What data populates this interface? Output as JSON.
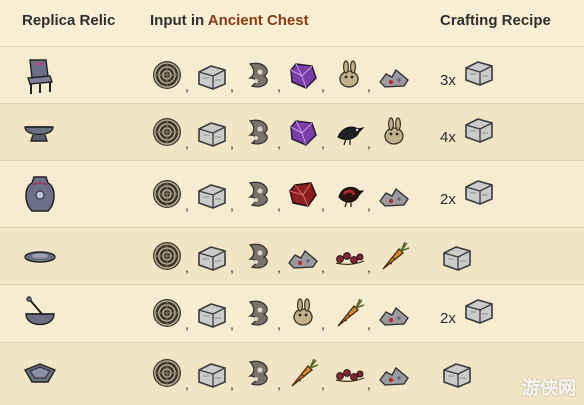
{
  "header": {
    "col_relic": "Replica Relic",
    "col_input_prefix": "Input in ",
    "col_input_accent": "Ancient Chest",
    "col_recipe": "Crafting Recipe"
  },
  "separator": ",",
  "rows": [
    {
      "relic_icon": "relic-chair-icon",
      "items": [
        "nightmare-fuel-icon",
        "thulecite-icon",
        "shadow-essence-icon",
        "purple-gem-icon",
        "rabbit-icon",
        "rocks-icon"
      ],
      "count": "3x",
      "recipe_icon": "thulecite-icon"
    },
    {
      "relic_icon": "relic-bowl-icon",
      "items": [
        "nightmare-fuel-icon",
        "thulecite-icon",
        "shadow-essence-icon",
        "purple-gem-icon",
        "crow-icon",
        "rabbit-icon"
      ],
      "count": "4x",
      "recipe_icon": "thulecite-icon"
    },
    {
      "relic_icon": "relic-vase-icon",
      "items": [
        "nightmare-fuel-icon",
        "thulecite-icon",
        "shadow-essence-icon",
        "red-gem-icon",
        "redbird-icon",
        "rocks-icon"
      ],
      "count": "2x",
      "recipe_icon": "thulecite-icon"
    },
    {
      "relic_icon": "relic-plate-icon",
      "items": [
        "nightmare-fuel-icon",
        "thulecite-icon",
        "shadow-essence-icon",
        "rocks-icon",
        "berries-icon",
        "carrot-icon"
      ],
      "count": "",
      "recipe_icon": "thulecite-icon"
    },
    {
      "relic_icon": "relic-bowl-spoon-icon",
      "items": [
        "nightmare-fuel-icon",
        "thulecite-icon",
        "shadow-essence-icon",
        "rabbit-icon",
        "carrot-icon",
        "rocks-icon"
      ],
      "count": "2x",
      "recipe_icon": "thulecite-icon"
    },
    {
      "relic_icon": "relic-dish-icon",
      "items": [
        "nightmare-fuel-icon",
        "thulecite-icon",
        "shadow-essence-icon",
        "carrot-icon",
        "berries-icon",
        "rocks-icon"
      ],
      "count": "",
      "recipe_icon": "thulecite-icon"
    }
  ],
  "watermark": "游侠网"
}
